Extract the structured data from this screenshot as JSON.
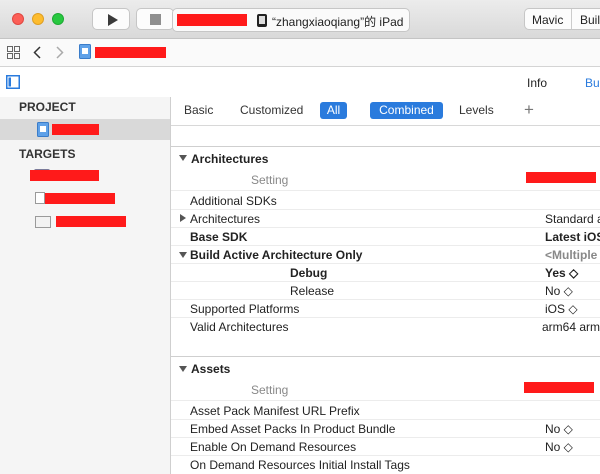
{
  "toolbar": {
    "device_name": "“zhangxiaoqiang”的 iPad",
    "right_item_1": "Mavic",
    "right_item_2": "Buil"
  },
  "subbar": {
    "info_tab": "Info",
    "build_tab": "Buil"
  },
  "sidebar": {
    "project_header": "PROJECT",
    "targets_header": "TARGETS"
  },
  "tabs": {
    "basic": "Basic",
    "customized": "Customized",
    "all": "All",
    "combined": "Combined",
    "levels": "Levels",
    "add": "+"
  },
  "architectures": {
    "title": "Architectures",
    "setting_header": "Setting",
    "rows": [
      {
        "label": "Additional SDKs",
        "value": ""
      },
      {
        "label": "Architectures",
        "value": "Standard a"
      },
      {
        "label": "Base SDK",
        "value": "Latest iOS"
      },
      {
        "label": "Build Active Architecture Only",
        "value": "<Multiple"
      },
      {
        "label": "Debug",
        "value": "Yes ◇"
      },
      {
        "label": "Release",
        "value": "No ◇"
      },
      {
        "label": "Supported Platforms",
        "value": "iOS ◇"
      },
      {
        "label": "Valid Architectures",
        "value": "arm64 arm"
      }
    ]
  },
  "assets": {
    "title": "Assets",
    "setting_header": "Setting",
    "rows": [
      {
        "label": "Asset Pack Manifest URL Prefix",
        "value": ""
      },
      {
        "label": "Embed Asset Packs In Product Bundle",
        "value": "No ◇"
      },
      {
        "label": "Enable On Demand Resources",
        "value": "No ◇"
      },
      {
        "label": "On Demand Resources Initial Install Tags",
        "value": ""
      }
    ]
  }
}
